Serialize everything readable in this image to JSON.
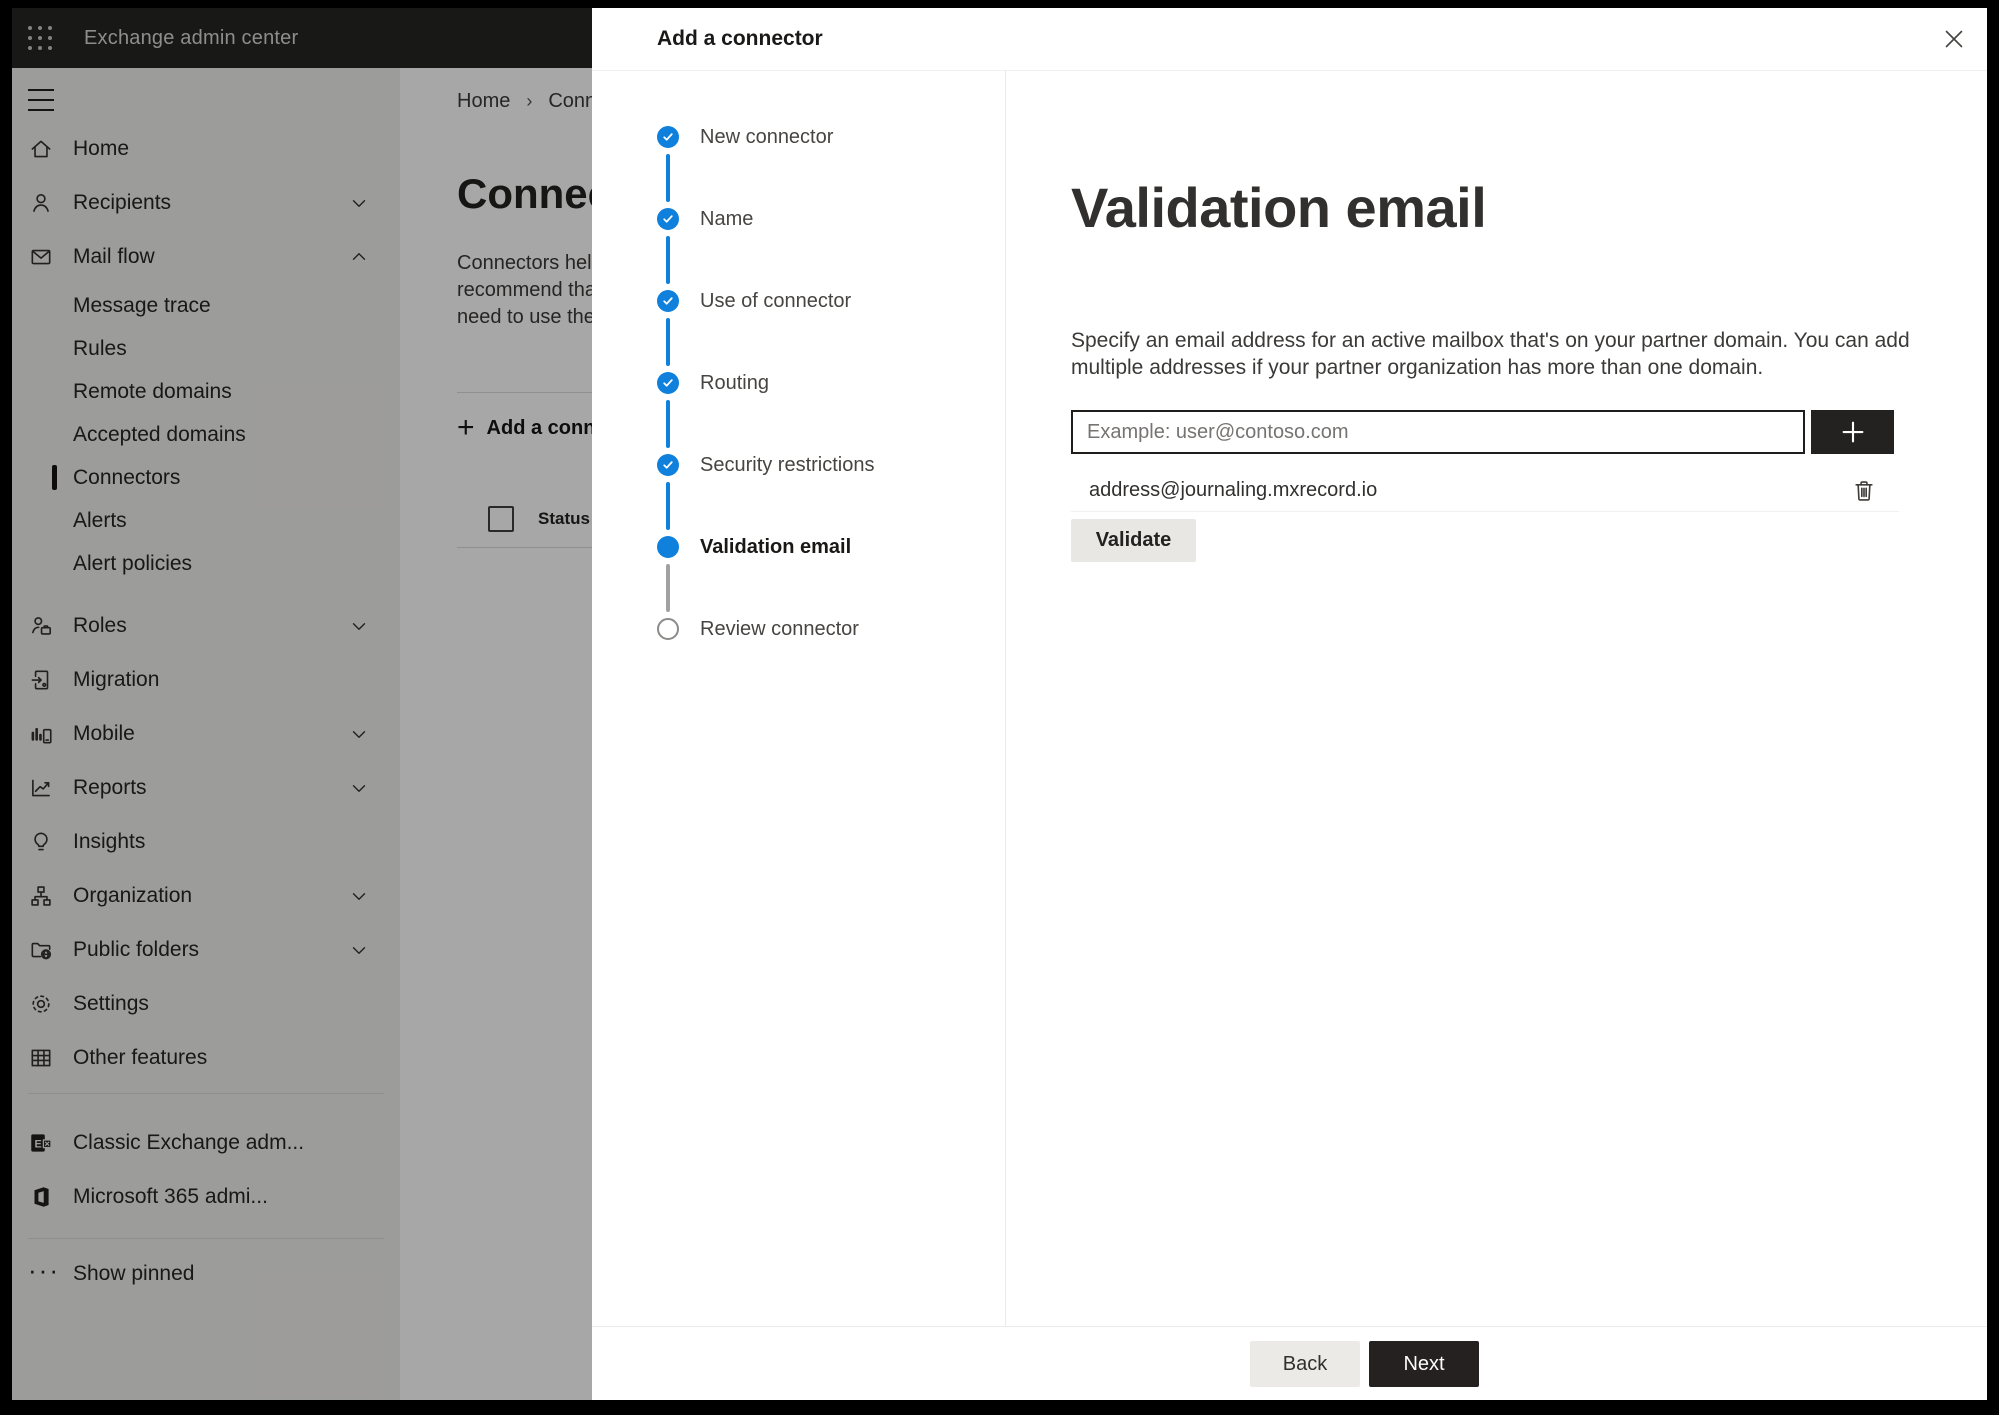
{
  "app_bar": {
    "title": "Exchange admin center"
  },
  "sidebar": {
    "items": [
      {
        "label": "Home",
        "icon": "home-icon"
      },
      {
        "label": "Recipients",
        "icon": "person-icon",
        "chevron": "down"
      },
      {
        "label": "Mail flow",
        "icon": "mail-icon",
        "chevron": "up",
        "expanded": true
      },
      {
        "label": "Roles",
        "icon": "roles-icon",
        "chevron": "down"
      },
      {
        "label": "Migration",
        "icon": "migration-icon"
      },
      {
        "label": "Mobile",
        "icon": "mobile-icon",
        "chevron": "down"
      },
      {
        "label": "Reports",
        "icon": "reports-icon",
        "chevron": "down"
      },
      {
        "label": "Insights",
        "icon": "lightbulb-icon"
      },
      {
        "label": "Organization",
        "icon": "org-icon",
        "chevron": "down"
      },
      {
        "label": "Public folders",
        "icon": "folder-globe-icon",
        "chevron": "down"
      },
      {
        "label": "Settings",
        "icon": "gear-icon"
      },
      {
        "label": "Other features",
        "icon": "table-icon"
      }
    ],
    "mailflow_children": [
      {
        "label": "Message trace"
      },
      {
        "label": "Rules"
      },
      {
        "label": "Remote domains"
      },
      {
        "label": "Accepted domains"
      },
      {
        "label": "Connectors",
        "selected": true
      },
      {
        "label": "Alerts"
      },
      {
        "label": "Alert policies"
      }
    ],
    "footer_items": [
      {
        "label": "Classic Exchange adm...",
        "icon": "exchange-logo-icon"
      },
      {
        "label": "Microsoft 365 admi...",
        "icon": "office-logo-icon"
      },
      {
        "label": "Show pinned",
        "icon": "ellipsis-icon"
      }
    ]
  },
  "page": {
    "breadcrumb": {
      "home": "Home",
      "current": "Connectors"
    },
    "title": "Connectors",
    "description_lines": [
      "Connectors help",
      "recommend that",
      "need to use them"
    ],
    "add_button_label": "Add a connector",
    "table": {
      "status_header": "Status"
    }
  },
  "dialog": {
    "title": "Add a connector",
    "steps": [
      {
        "label": "New connector",
        "state": "completed"
      },
      {
        "label": "Name",
        "state": "completed"
      },
      {
        "label": "Use of connector",
        "state": "completed"
      },
      {
        "label": "Routing",
        "state": "completed"
      },
      {
        "label": "Security restrictions",
        "state": "completed"
      },
      {
        "label": "Validation email",
        "state": "current"
      },
      {
        "label": "Review connector",
        "state": "upcoming"
      }
    ],
    "step_page": {
      "heading": "Validation email",
      "description": "Specify an email address for an active mailbox that's on your partner domain. You can add multiple addresses if your partner organization has more than one domain.",
      "email_input": {
        "placeholder": "Example: user@contoso.com",
        "value": ""
      },
      "addresses": [
        "address@journaling.mxrecord.io"
      ],
      "validate_button": "Validate"
    },
    "footer": {
      "back": "Back",
      "next": "Next"
    }
  },
  "colors": {
    "accent_blue": "#0f80dc",
    "app_bar_bg": "#262523",
    "panel_bg": "#ffffff",
    "primary_button_bg": "#242120",
    "neutral_button_bg": "#eceae7",
    "overlay": "rgba(0,0,0,0.345)"
  }
}
